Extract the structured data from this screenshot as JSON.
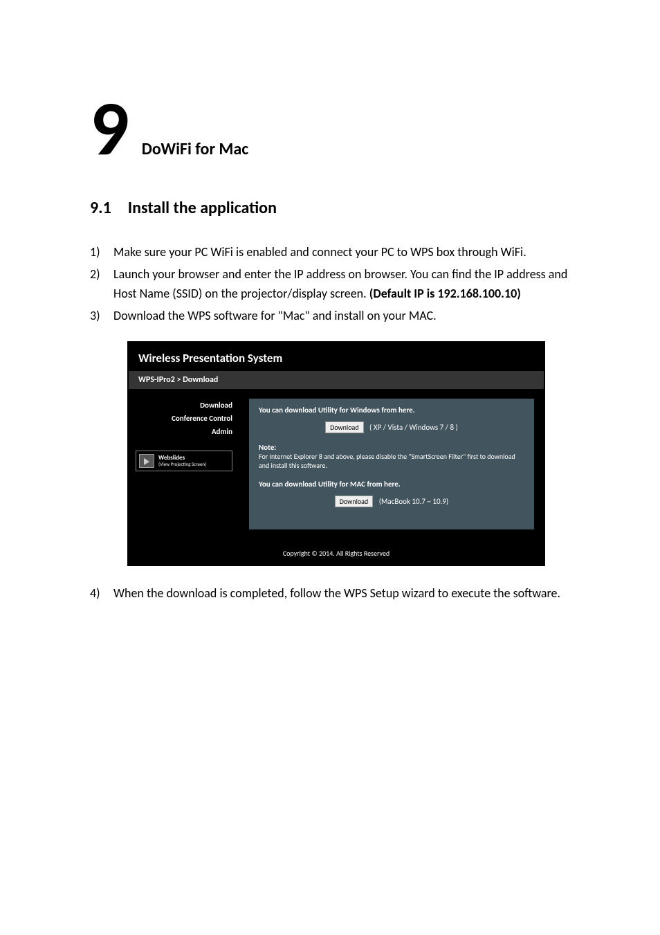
{
  "chapter": {
    "number": "9",
    "title": "DoWiFi for Mac"
  },
  "section": {
    "number": "9.1",
    "title": "Install the application"
  },
  "steps": {
    "s1": {
      "num": "1)",
      "text": "Make sure your PC WiFi is enabled and connect your PC to WPS box through WiFi."
    },
    "s2": {
      "num": "2)",
      "pre": "Launch your browser and enter the IP address on browser.    You can find the IP address and Host Name (SSID) on the projector/display screen. ",
      "bold": "(Default IP is 192.168.100.10)"
    },
    "s3": {
      "num": "3)",
      "text": "Download the WPS software for \"Mac\" and install on your MAC."
    },
    "s4": {
      "num": "4)",
      "text": "When the download is completed, follow the WPS Setup wizard to execute the software."
    }
  },
  "shot": {
    "title": "Wireless Presentation System",
    "breadcrumb": "WPS-IPro2 > Download",
    "side": {
      "download": "Download",
      "conference": "Conference Control",
      "admin": "Admin",
      "webslides_title": "Webslides",
      "webslides_sub": "(View Projecting Screen)"
    },
    "main": {
      "win_head": "You can download Utility for Windows from here.",
      "dl_btn": "Download",
      "win_suffix": "( XP / Vista / Windows 7 / 8 )",
      "note_head": "Note:",
      "note_body": "For Internet Explorer 8 and above, please disable the \"SmartScreen Filter\" first to download and install this software.",
      "mac_head": "You can download Utility for MAC from here.",
      "mac_suffix": "(MacBook 10.7 ~ 10.9)"
    },
    "footer": "Copyright © 2014. All Rights Reserved"
  }
}
